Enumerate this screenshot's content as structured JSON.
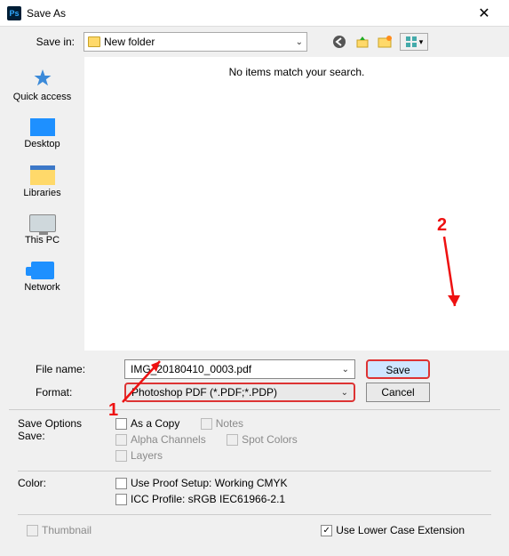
{
  "title": "Save As",
  "savein_label": "Save in:",
  "savein_value": "New folder",
  "empty_msg": "No items match your search.",
  "sidebar": {
    "items": [
      {
        "label": "Quick access"
      },
      {
        "label": "Desktop"
      },
      {
        "label": "Libraries"
      },
      {
        "label": "This PC"
      },
      {
        "label": "Network"
      }
    ]
  },
  "filename_label": "File name:",
  "filename_value": "IMG_20180410_0003.pdf",
  "format_label": "Format:",
  "format_value": "Photoshop PDF (*.PDF;*.PDP)",
  "save_btn": "Save",
  "cancel_btn": "Cancel",
  "save_options_title": "Save Options",
  "save_subtitle": "Save:",
  "cb_asacopy": "As a Copy",
  "cb_notes": "Notes",
  "cb_alpha": "Alpha Channels",
  "cb_spot": "Spot Colors",
  "cb_layers": "Layers",
  "color_title": "Color:",
  "cb_proof": "Use Proof Setup:  Working CMYK",
  "cb_icc": "ICC Profile:  sRGB IEC61966-2.1",
  "cb_thumb": "Thumbnail",
  "cb_lce": "Use Lower Case Extension",
  "annotations": {
    "one": "1",
    "two": "2"
  }
}
